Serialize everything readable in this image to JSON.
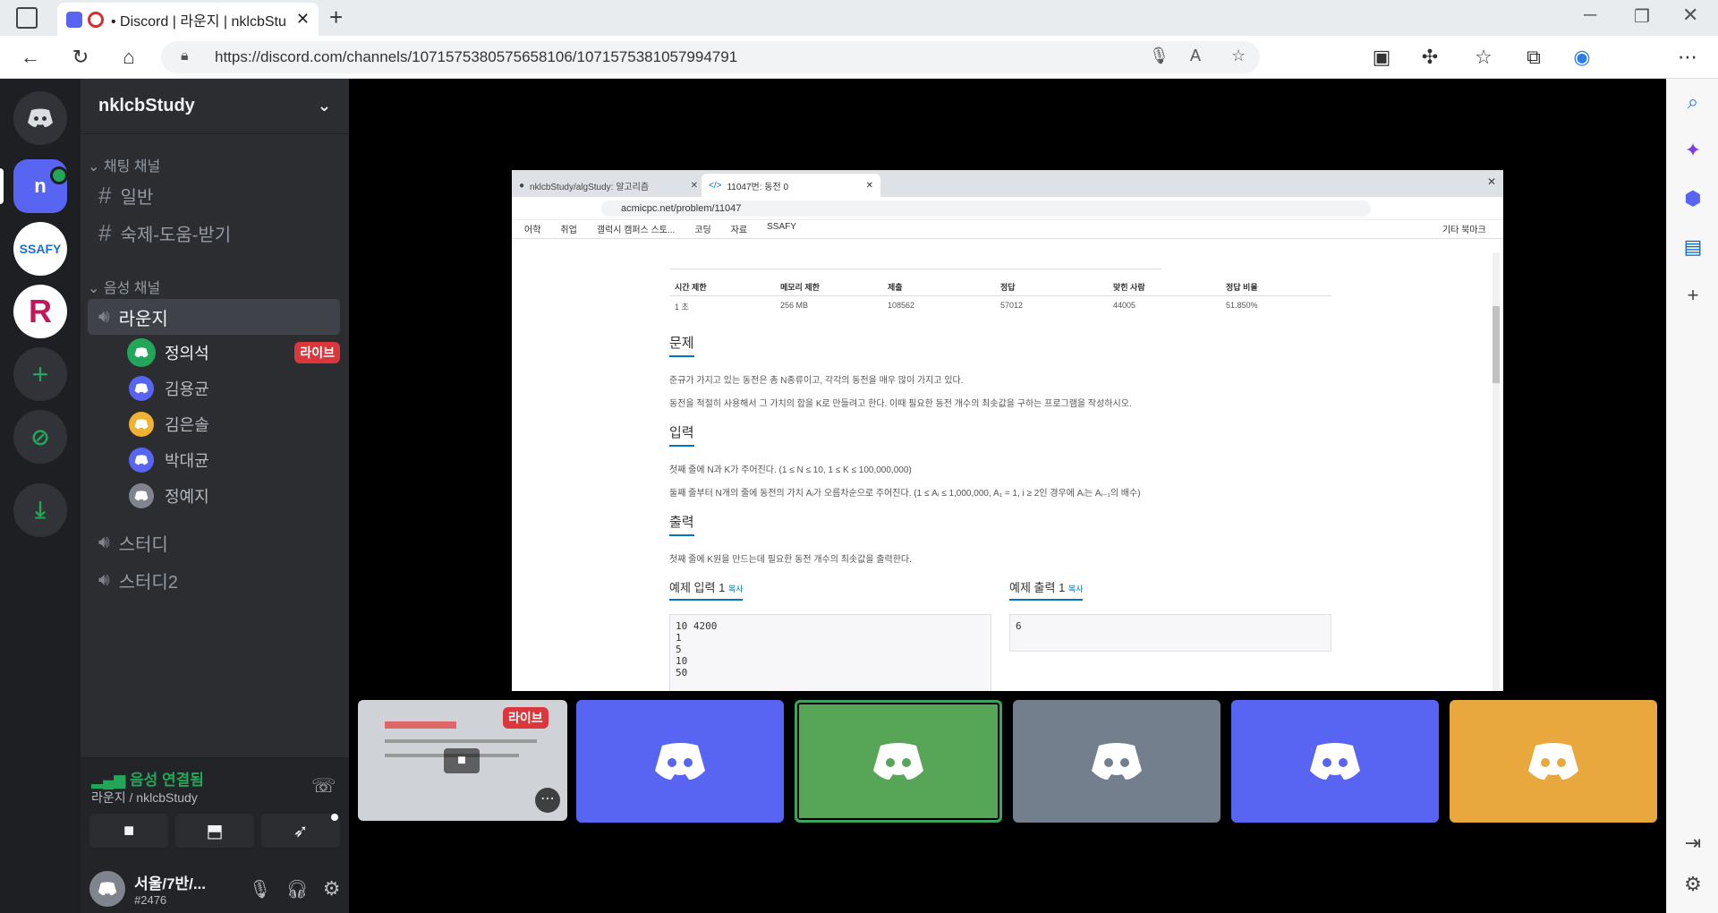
{
  "browser": {
    "tab_title": "• Discord | 라운지 | nklcbStu",
    "url": "https://discord.com/channels/1071575380575658106/1071575381057994791"
  },
  "discord": {
    "server_name": "nklcbStudy",
    "server_initial": "n",
    "text_category": "채팅 채널",
    "text_channels": [
      "일반",
      "숙제-도움-받기"
    ],
    "voice_category": "음성 채널",
    "voice_channels": [
      "라운지",
      "스터디",
      "스터디2"
    ],
    "members": [
      {
        "name": "정의석",
        "color": "#23a55a",
        "live": true
      },
      {
        "name": "김용균",
        "color": "#5865f2",
        "live": false
      },
      {
        "name": "김은솔",
        "color": "#f0b232",
        "live": false
      },
      {
        "name": "박대균",
        "color": "#5865f2",
        "live": false
      },
      {
        "name": "정예지",
        "color": "#80848e",
        "live": false
      }
    ],
    "live_badge": "라이브",
    "voice_status": "음성 연결됨",
    "voice_location": "라운지 / nklcbStudy",
    "user_name": "서울/7반/...",
    "user_tag": "#2476",
    "tiles": [
      {
        "color": "#5865f2"
      },
      {
        "color": "#57a657",
        "speaking": true
      },
      {
        "color": "#747f8d"
      },
      {
        "color": "#5865f2"
      },
      {
        "color": "#e8a83e"
      }
    ]
  },
  "share": {
    "tab1": "nklcbStudy/algStudy: 알고리즘",
    "tab2": "11047번: 동전 0",
    "url": "acmicpc.net/problem/11047",
    "bookmarks": [
      "어학",
      "취업",
      "갤럭시 캠퍼스 스토...",
      "코딩",
      "자료",
      "SSAFY"
    ],
    "other_bookmarks": "기타 북마크",
    "table_headers": [
      "시간 제한",
      "메모리 제한",
      "제출",
      "정답",
      "맞힌 사람",
      "정답 비율"
    ],
    "table_values": [
      "1 초",
      "256 MB",
      "108562",
      "57012",
      "44005",
      "51.850%"
    ],
    "problem_title": "문제",
    "problem_p1": "준규가 가지고 있는 동전은 총 N종류이고, 각각의 동전을 매우 많이 가지고 있다.",
    "problem_p2": "동전을 적절히 사용해서 그 가치의 합을 K로 만들려고 한다. 이때 필요한 동전 개수의 최솟값을 구하는 프로그램을 작성하시오.",
    "input_title": "입력",
    "input_p1": "첫째 줄에 N과 K가 주어진다. (1 ≤ N ≤ 10, 1 ≤ K ≤ 100,000,000)",
    "input_p2": "둘째 줄부터 N개의 줄에 동전의 가치 Aᵢ가 오름차순으로 주어진다. (1 ≤ Aᵢ ≤ 1,000,000, A₁ = 1, i ≥ 2인 경우에 Aᵢ는 Aᵢ₋₁의 배수)",
    "output_title": "출력",
    "output_p1": "첫째 줄에 K원을 만드는데 필요한 동전 개수의 최솟값을 출력한다.",
    "sample_in_title": "예제 입력 1",
    "sample_out_title": "예제 출력 1",
    "copy": "복사",
    "sample_in": [
      "10 4200",
      "1",
      "5",
      "10",
      "50"
    ],
    "sample_out": "6"
  }
}
